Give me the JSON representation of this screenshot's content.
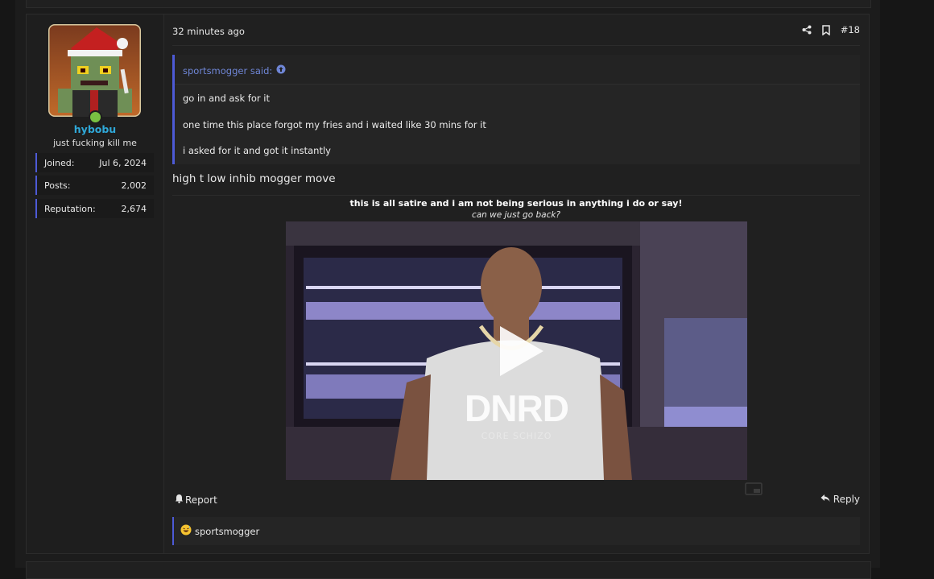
{
  "post": {
    "author": {
      "username": "hybobu",
      "title": "just fucking kill me",
      "online": true,
      "stats": [
        {
          "label": "Joined:",
          "value": "Jul 6, 2024"
        },
        {
          "label": "Posts:",
          "value": "2,002"
        },
        {
          "label": "Reputation:",
          "value": "2,674"
        }
      ]
    },
    "time_ago": "32 minutes ago",
    "number": "#18",
    "actions": {
      "share_icon": "share-icon",
      "bookmark_icon": "bookmark-icon"
    },
    "quote": {
      "author_label": "sportsmogger said:",
      "lines": [
        "go in and ask for it",
        "one time this place forgot my fries and i waited like 30 mins for it",
        "i asked for it and got it instantly"
      ]
    },
    "message": "high t low inhib mogger move",
    "signature": {
      "line1": "this is all satire and i am not being serious in anything i do or say!",
      "line2": "can we just go back?"
    },
    "video": {
      "watermark": "DNRD",
      "watermark_sub": "CORE SCHIZO"
    },
    "footer": {
      "report_label": "Report",
      "reply_label": "Reply"
    },
    "reactions": {
      "icon": "grinning-sweat-emoji",
      "users": "sportsmogger"
    }
  },
  "colors": {
    "accent": "#4d5ad6",
    "username": "#2fa8d8",
    "quote_author": "#6f86d6",
    "online": "#7ac142"
  }
}
